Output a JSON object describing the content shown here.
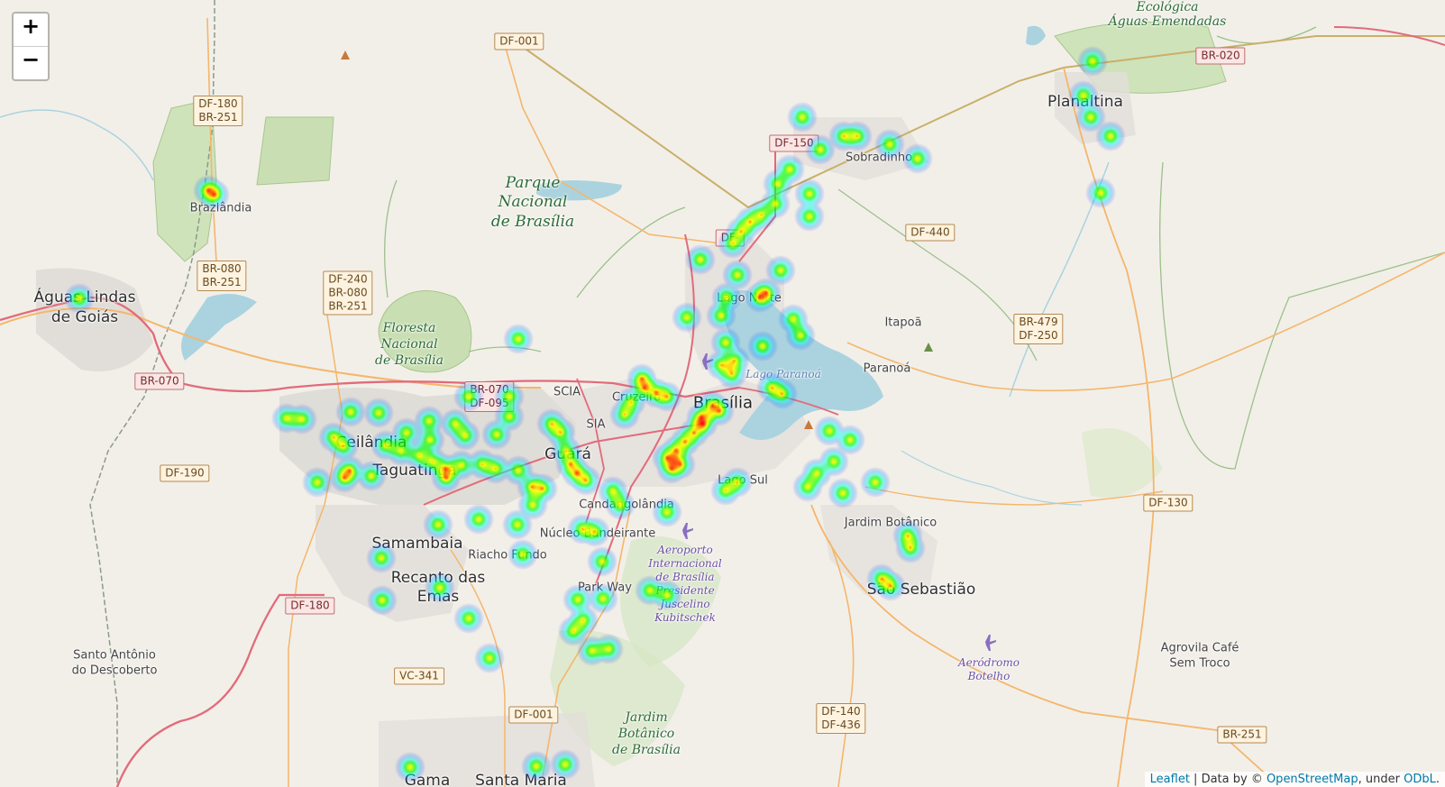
{
  "map": {
    "zoom_in_label": "+",
    "zoom_out_label": "−",
    "attribution": {
      "leaflet": "Leaflet",
      "sep": " | Data by © ",
      "osm": "OpenStreetMap",
      "under": ", under ",
      "odbl": "ODbL",
      "end": "."
    },
    "places": [
      {
        "t": "Ecológica",
        "c": "top"
      },
      {
        "t": "Águas Emendadas",
        "c": "top"
      },
      {
        "t": "Planaltina",
        "c": "city"
      },
      {
        "t": "Sobradinho",
        "c": "town"
      },
      {
        "t": "Parque",
        "c": "park"
      },
      {
        "t": "Nacional",
        "c": "park"
      },
      {
        "t": "de Brasília",
        "c": "park"
      },
      {
        "t": "Brazlândia",
        "c": "town"
      },
      {
        "t": "Águas Lindas",
        "c": "city"
      },
      {
        "t": "de Goiás",
        "c": "city"
      },
      {
        "t": "Floresta",
        "c": "parksm"
      },
      {
        "t": "Nacional",
        "c": "parksm"
      },
      {
        "t": "de Brasília",
        "c": "parksm"
      },
      {
        "t": "Itapoã",
        "c": "town"
      },
      {
        "t": "Paranoá",
        "c": "town"
      },
      {
        "t": "Lago Norte",
        "c": "town"
      },
      {
        "t": "Lago Paranoá",
        "c": "water"
      },
      {
        "t": "Brasília",
        "c": "big"
      },
      {
        "t": "SCIA",
        "c": "town"
      },
      {
        "t": "Cruzeiro",
        "c": "town"
      },
      {
        "t": "SIA",
        "c": "town"
      },
      {
        "t": "Ceilândia",
        "c": "city"
      },
      {
        "t": "Taguatinga",
        "c": "city"
      },
      {
        "t": "Guará",
        "c": "city"
      },
      {
        "t": "Lago Sul",
        "c": "town"
      },
      {
        "t": "Candangolândia",
        "c": "town"
      },
      {
        "t": "Núcleo Bandeirante",
        "c": "town"
      },
      {
        "t": "Jardim Botânico",
        "c": "town"
      },
      {
        "t": "Samambaia",
        "c": "city"
      },
      {
        "t": "Riacho Fundo",
        "c": "town"
      },
      {
        "t": "Recanto das",
        "c": "city"
      },
      {
        "t": "Emas",
        "c": "city"
      },
      {
        "t": "Aeroporto",
        "c": "airport"
      },
      {
        "t": "Internacional",
        "c": "airport"
      },
      {
        "t": "de Brasília",
        "c": "airport"
      },
      {
        "t": "Presidente",
        "c": "airport"
      },
      {
        "t": "Juscelino",
        "c": "airport"
      },
      {
        "t": "Kubitschek",
        "c": "airport"
      },
      {
        "t": "Park Way",
        "c": "town"
      },
      {
        "t": "São Sebastião",
        "c": "city"
      },
      {
        "t": "Santo Antônio",
        "c": "town"
      },
      {
        "t": "do Descoberto",
        "c": "town"
      },
      {
        "t": "Agrovila Café",
        "c": "town"
      },
      {
        "t": "Sem Troco",
        "c": "town"
      },
      {
        "t": "Aeródromo",
        "c": "airport"
      },
      {
        "t": "Botelho",
        "c": "airport"
      },
      {
        "t": "Jardim",
        "c": "parksm"
      },
      {
        "t": "Botânico",
        "c": "parksm"
      },
      {
        "t": "de Brasília",
        "c": "parksm"
      },
      {
        "t": "Gama",
        "c": "city"
      },
      {
        "t": "Santa Maria",
        "c": "city"
      }
    ],
    "shields": [
      {
        "lines": [
          "DF-001"
        ],
        "red": false
      },
      {
        "lines": [
          "BR-020"
        ],
        "red": true
      },
      {
        "lines": [
          "DF-180",
          "BR-251"
        ],
        "red": false
      },
      {
        "lines": [
          "DF-150"
        ],
        "red": true
      },
      {
        "lines": [
          "DF-440"
        ],
        "red": false
      },
      {
        "lines": [
          "BR-080",
          "BR-251"
        ],
        "red": false
      },
      {
        "lines": [
          "DF-240",
          "BR-080",
          "BR-251"
        ],
        "red": false
      },
      {
        "lines": [
          "BR-479",
          "DF-250"
        ],
        "red": false
      },
      {
        "lines": [
          "BR-070"
        ],
        "red": true
      },
      {
        "lines": [
          "BR-070",
          "DF-095"
        ],
        "red": true
      },
      {
        "lines": [
          "DF-190"
        ],
        "red": false
      },
      {
        "lines": [
          "DF-130"
        ],
        "red": false
      },
      {
        "lines": [
          "DF-180"
        ],
        "red": true
      },
      {
        "lines": [
          "VC-341"
        ],
        "red": false
      },
      {
        "lines": [
          "DF-001"
        ],
        "red": false
      },
      {
        "lines": [
          "DF-140",
          "DF-436"
        ],
        "red": false
      },
      {
        "lines": [
          "BR-251"
        ],
        "red": false
      },
      {
        "lines": [
          "DF-"
        ],
        "red": true
      }
    ],
    "colors": {
      "land": "#f2efe9",
      "park": "#c9dfb3",
      "water": "#aad3df",
      "urban": "#dcd9d4",
      "highway": "#e26b7a",
      "trunk": "#f5b66b",
      "boundary": "#8c9a8c"
    }
  }
}
